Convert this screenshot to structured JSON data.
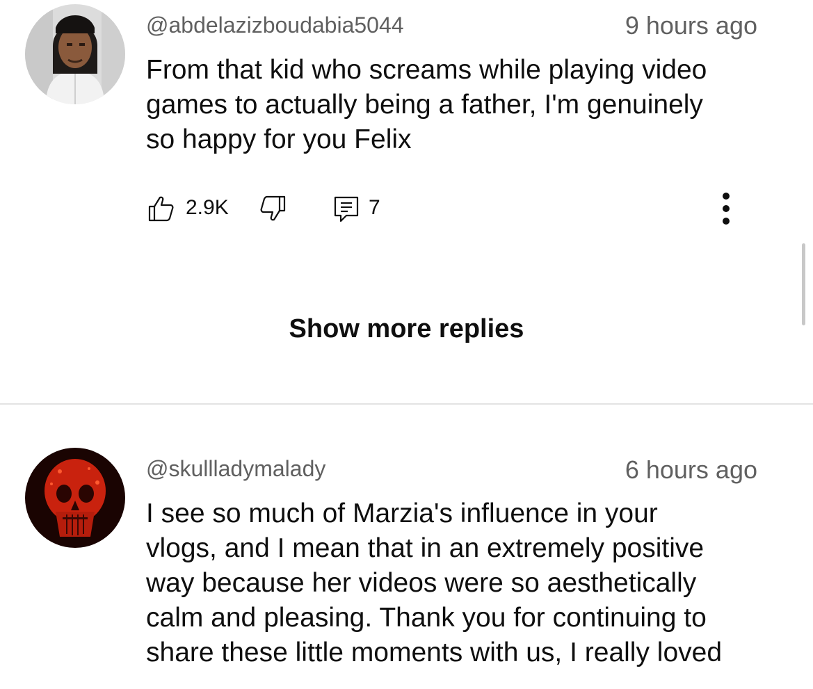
{
  "comments": [
    {
      "handle": "@abdelazizboudabia5044",
      "time": "9 hours ago",
      "lines": [
        "From that kid who screams while playing video",
        "games to actually being a father, I'm genuinely",
        "so happy for you Felix"
      ],
      "likes": "2.9K",
      "replies": "7",
      "avatar_icon": "person-avatar-icon"
    },
    {
      "handle": "@skullladymalady",
      "time": "6 hours ago",
      "lines": [
        "I see so much of Marzia's influence in your",
        "vlogs, and I mean that in an extremely positive",
        "way because her videos were so aesthetically",
        "calm and pleasing. Thank you for continuing to",
        "share these little moments with us, I really loved"
      ],
      "avatar_icon": "red-skull-avatar-icon"
    }
  ],
  "show_more_replies": "Show more replies",
  "icons": {
    "like": "thumbs-up-icon",
    "dislike": "thumbs-down-icon",
    "reply": "reply-comment-icon",
    "more": "more-vertical-icon"
  },
  "colors": {
    "text_primary": "#0f0f0f",
    "text_secondary": "#606060",
    "divider": "#e3e3e3"
  }
}
